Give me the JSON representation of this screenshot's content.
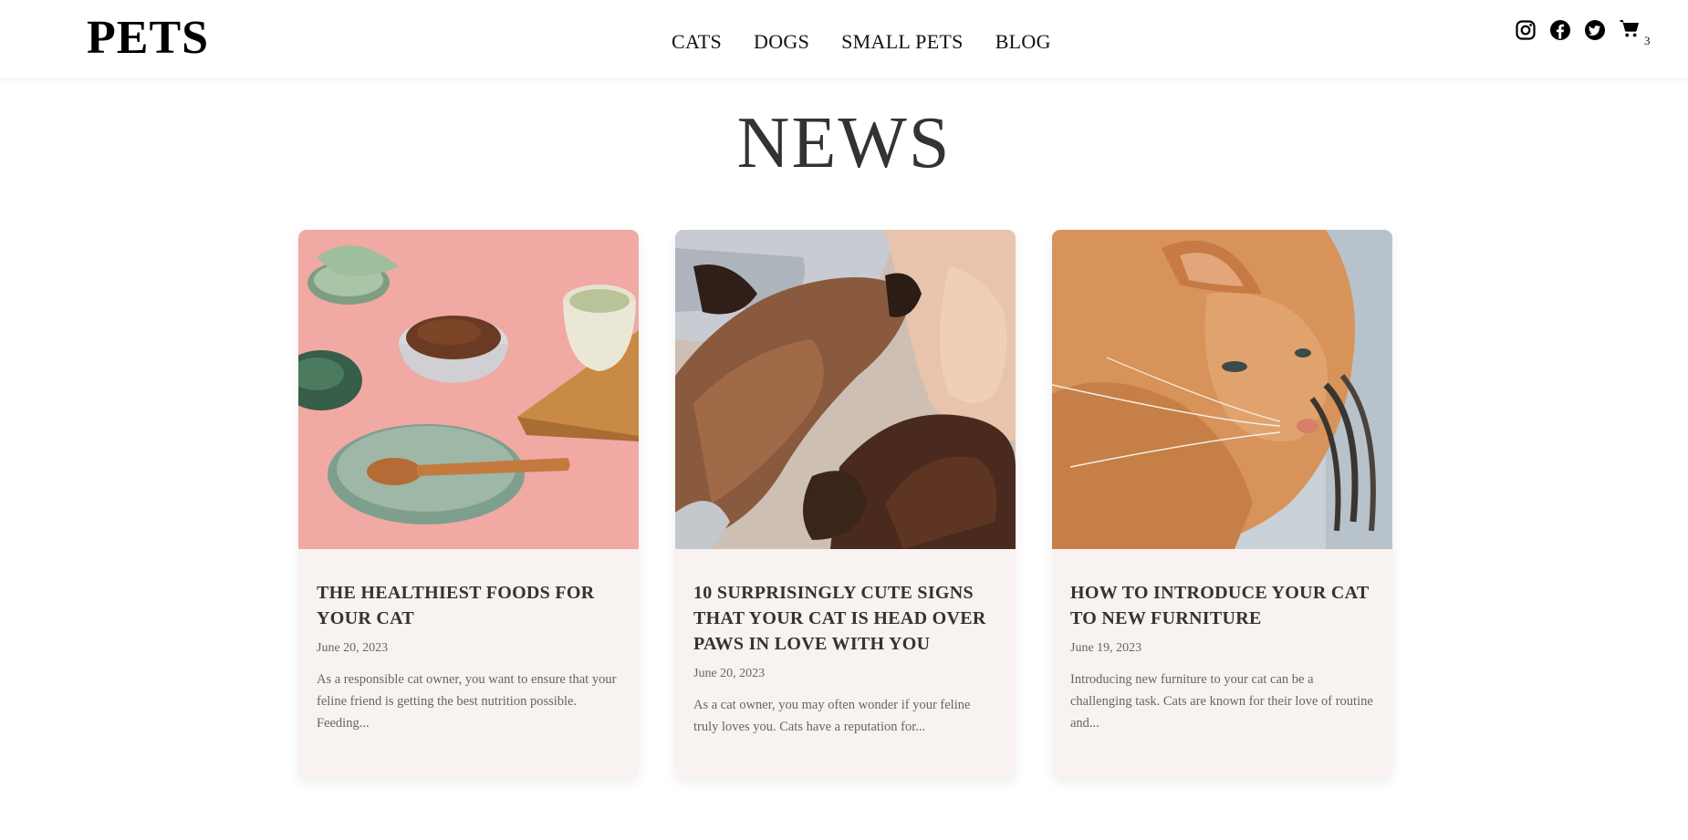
{
  "header": {
    "logo": "PETS",
    "nav": [
      "CATS",
      "DOGS",
      "SMALL PETS",
      "BLOG"
    ],
    "icons": [
      "instagram-icon",
      "facebook-icon",
      "twitter-icon",
      "cart-icon"
    ],
    "cart_count": "3"
  },
  "page": {
    "title": "NEWS"
  },
  "articles": [
    {
      "title": "THE HEALTHIEST FOODS FOR YOUR CAT",
      "date": "June 20, 2023",
      "excerpt": "As a responsible cat owner, you want to ensure that your feline friend is getting the best nutrition possible. Feeding..."
    },
    {
      "title": "10 SURPRISINGLY CUTE SIGNS THAT YOUR CAT IS HEAD OVER PAWS IN LOVE WITH YOU",
      "date": "June 20, 2023",
      "excerpt": "As a cat owner, you may often wonder if your feline truly loves you. Cats have a reputation for..."
    },
    {
      "title": "HOW TO INTRODUCE YOUR CAT TO NEW FURNITURE",
      "date": "June 19, 2023",
      "excerpt": "Introducing new furniture to your cat can be a challenging task. Cats are known for their love of routine and..."
    }
  ],
  "colors": {
    "card_background": "#f8f2f0",
    "title_text": "#333333",
    "muted_text": "#666666"
  }
}
